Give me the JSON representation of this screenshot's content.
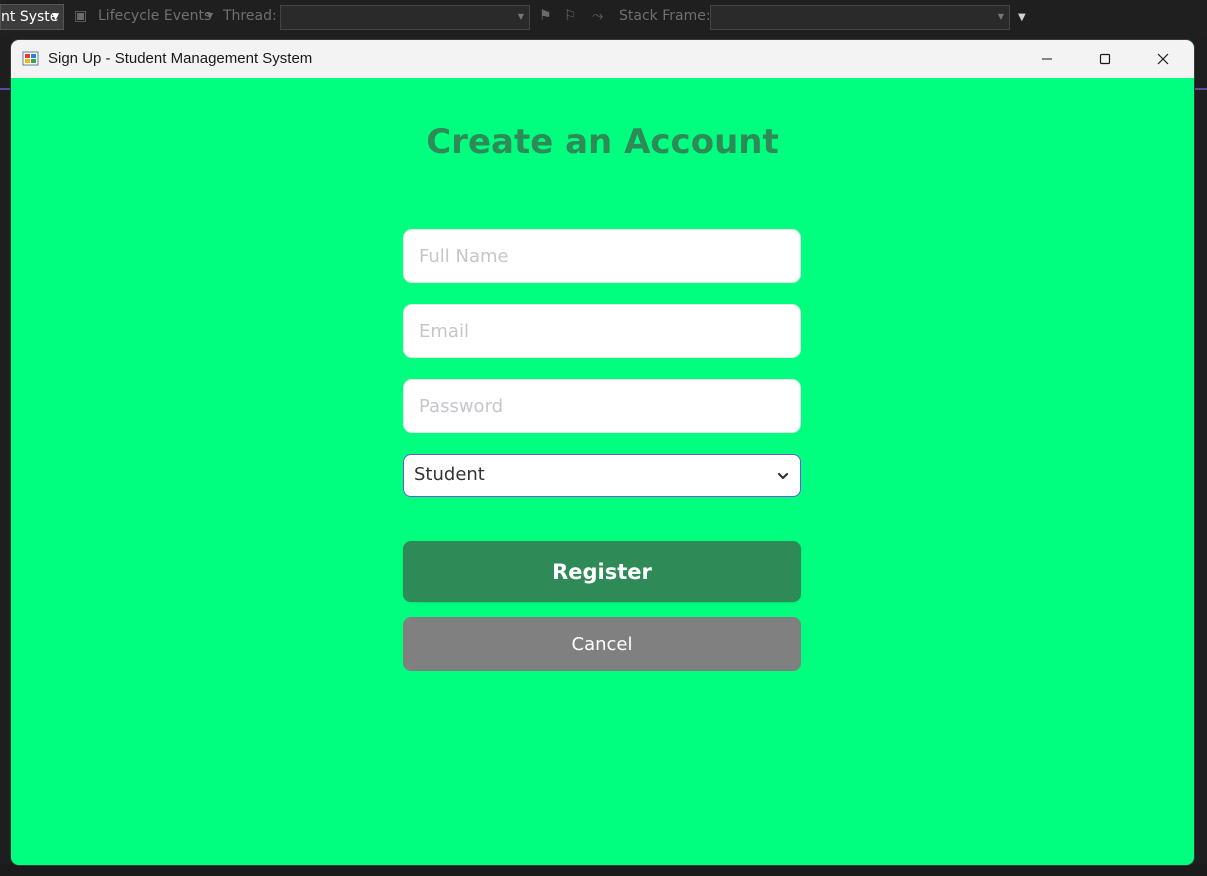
{
  "ide": {
    "target_dropdown_text": "nt Syste",
    "lifecycle_label": "Lifecycle Events",
    "thread_label": "Thread:",
    "stack_frame_label": "Stack Frame:"
  },
  "window": {
    "title": "Sign Up - Student Management System"
  },
  "form": {
    "heading": "Create an Account",
    "full_name": {
      "placeholder": "Full Name",
      "value": ""
    },
    "email": {
      "placeholder": "Email",
      "value": ""
    },
    "password": {
      "placeholder": "Password",
      "value": ""
    },
    "role": {
      "selected": "Student"
    },
    "register_label": "Register",
    "cancel_label": "Cancel"
  },
  "colors": {
    "background": "#00ff7f",
    "heading": "#2e8b57",
    "register_button": "#2e8b57",
    "cancel_button": "#808080",
    "select_border": "#6a5acd"
  },
  "icons": {
    "app": "windows-forms-app-icon",
    "minimize": "minimize-icon",
    "maximize": "maximize-icon",
    "close": "close-icon",
    "dropdown": "chevron-down-icon"
  }
}
